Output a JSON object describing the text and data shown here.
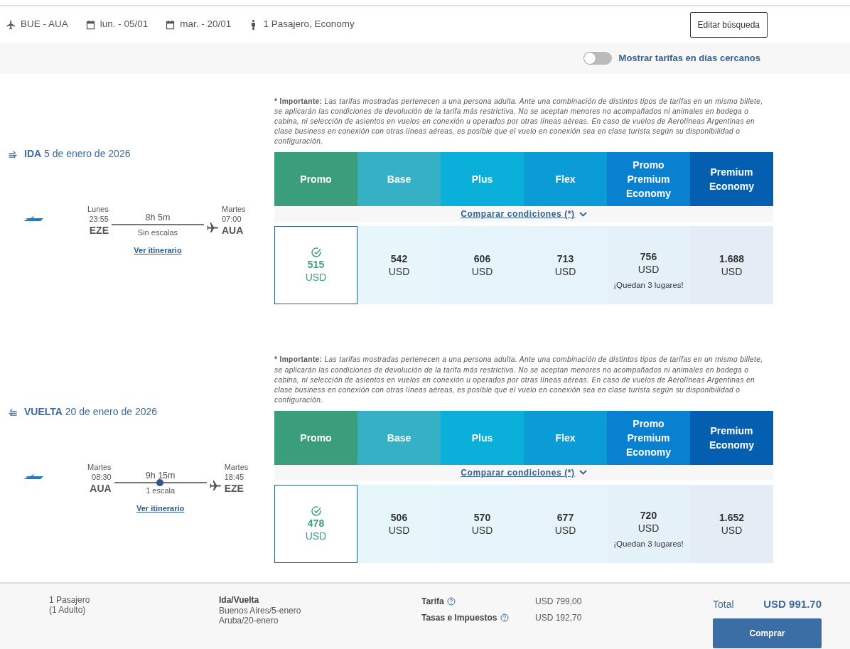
{
  "search_summary": {
    "items": [
      {
        "kind": "route",
        "text": "BUE - AUA"
      },
      {
        "kind": "date",
        "text": "lun. - 05/01"
      },
      {
        "kind": "date",
        "text": "mar. - 20/01"
      },
      {
        "kind": "passengers",
        "text": "1 Pasajero, Economy"
      }
    ],
    "edit_button": "Editar búsqueda"
  },
  "nearby_days_toggle": {
    "label": "Mostrar tarifas en días cercanos",
    "on": false
  },
  "legs": [
    {
      "kind": "outbound",
      "label": "IDA",
      "date": "5 de enero de 2026",
      "note_label": "* Importante:",
      "note": "Las tarifas mostradas pertenecen a una persona adulta. Ante una combinación de distintos tipos de tarifas en un mismo billete, se aplicarán las condiciones de devolución de la tarifa más restrictiva. No se aceptan menores no acompañados ni animales en bodega o cabina, ni selección de asientos en vuelos en conexión u operados por otras líneas aéreas. En caso de vuelos de Aerolíneas Argentinas en clase business en conexión con otras líneas aéreas, es posible que el vuelo en conexión sea en clase turista según su disponibilidad o configuración.",
      "flight": {
        "departure": {
          "day": "Lunes",
          "time": "23:55",
          "airport": "EZE"
        },
        "duration": "8h 5m",
        "stops": "Sin escalas",
        "stopover": false,
        "arrival": {
          "day": "Martes",
          "time": "07:00",
          "airport": "AUA"
        },
        "itinerary_link": "Ver itinerario"
      },
      "compare_link": "Comparar condiciones (*)",
      "fares": [
        {
          "name": "Promo",
          "color": "#3a9e7d",
          "price": "515",
          "currency": "USD",
          "selected": true
        },
        {
          "name": "Base",
          "color": "#35b0c4",
          "price": "542",
          "currency": "USD",
          "selected": false
        },
        {
          "name": "Plus",
          "color": "#0ab0d9",
          "price": "606",
          "currency": "USD",
          "selected": false
        },
        {
          "name": "Flex",
          "color": "#0b9bd6",
          "price": "713",
          "currency": "USD",
          "selected": false
        },
        {
          "name": "Promo Premium Economy",
          "color": "#0a80d0",
          "price": "756",
          "currency": "USD",
          "selected": false,
          "availability": "¡Quedan 3 lugares!"
        },
        {
          "name": "Premium Economy",
          "color": "#045fb0",
          "price": "1.688",
          "currency": "USD",
          "selected": false
        }
      ]
    },
    {
      "kind": "return",
      "label": "VUELTA",
      "date": "20 de enero de 2026",
      "note_label": "* Importante:",
      "note": "Las tarifas mostradas pertenecen a una persona adulta. Ante una combinación de distintos tipos de tarifas en un mismo billete, se aplicarán las condiciones de devolución de la tarifa más restrictiva. No se aceptan menores no acompañados ni animales en bodega o cabina, ni selección de asientos en vuelos en conexión u operados por otras líneas aéreas. En caso de vuelos de Aerolíneas Argentinas en clase business en conexión con otras líneas aéreas, es posible que el vuelo en conexión sea en clase turista según su disponibilidad o configuración.",
      "flight": {
        "departure": {
          "day": "Martes",
          "time": "08:30",
          "airport": "AUA"
        },
        "duration": "9h 15m",
        "stops": "1 escala",
        "stopover": true,
        "arrival": {
          "day": "Martes",
          "time": "18:45",
          "airport": "EZE"
        },
        "itinerary_link": "Ver itinerario"
      },
      "compare_link": "Comparar condiciones (*)",
      "fares": [
        {
          "name": "Promo",
          "color": "#3a9e7d",
          "price": "478",
          "currency": "USD",
          "selected": true
        },
        {
          "name": "Base",
          "color": "#35b0c4",
          "price": "506",
          "currency": "USD",
          "selected": false
        },
        {
          "name": "Plus",
          "color": "#0ab0d9",
          "price": "570",
          "currency": "USD",
          "selected": false
        },
        {
          "name": "Flex",
          "color": "#0b9bd6",
          "price": "677",
          "currency": "USD",
          "selected": false
        },
        {
          "name": "Promo Premium Economy",
          "color": "#0a80d0",
          "price": "720",
          "currency": "USD",
          "selected": false,
          "availability": "¡Quedan 3 lugares!"
        },
        {
          "name": "Premium Economy",
          "color": "#045fb0",
          "price": "1.652",
          "currency": "USD",
          "selected": false
        }
      ]
    }
  ],
  "summary_bar": {
    "passengers": [
      "1 Pasajero",
      "(1 Adulto)"
    ],
    "trip": {
      "title": "Ida/Vuelta",
      "lines": [
        "Buenos Aires/5-enero",
        "Aruba/20-enero"
      ]
    },
    "charges": [
      {
        "label": "Tarifa",
        "value": "USD 799,00"
      },
      {
        "label": "Tasas e Impuestos",
        "value": "USD 192,70"
      }
    ],
    "total_label": "Total",
    "total_value": "USD 991.70",
    "buy_button": "Comprar"
  }
}
